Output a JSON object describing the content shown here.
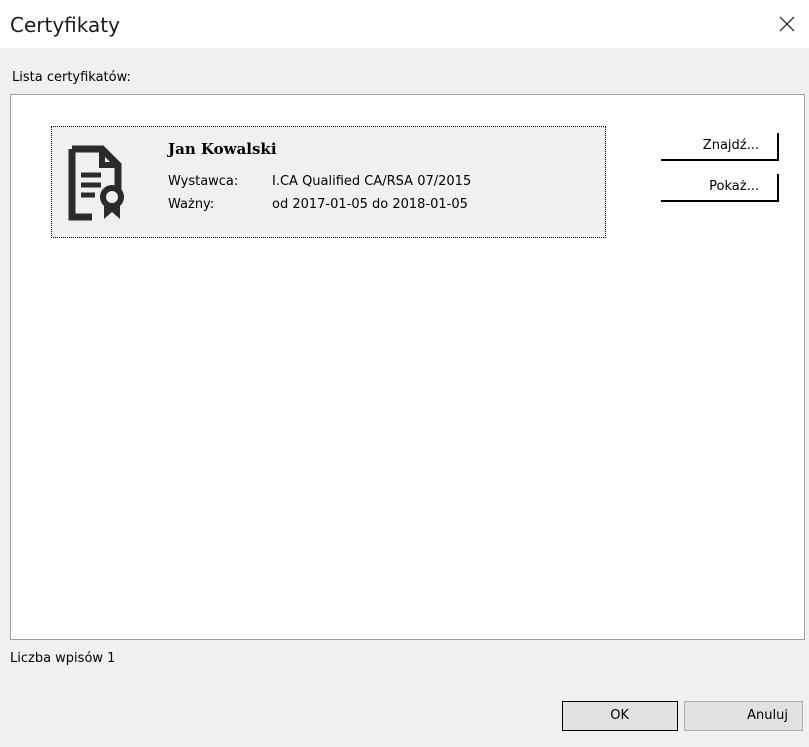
{
  "window": {
    "title": "Certyfikaty"
  },
  "certificates": {
    "list_label": "Lista certyfikatów:",
    "items": [
      {
        "name": "Jan Kowalski",
        "issuer_label": "Wystawca:",
        "issuer": "I.CA Qualified CA/RSA 07/2015",
        "valid_label": "Ważny:",
        "valid": "od 2017-01-05 do 2018-01-05",
        "icon": "certificate-icon"
      }
    ],
    "find_label": "Znajdź...",
    "show_label": "Pokaż...",
    "count_label": "Liczba wpisów 1"
  },
  "footer": {
    "ok_label": "OK",
    "cancel_label": "Anuluj"
  },
  "icons": {
    "close": "close-icon",
    "certificate": "certificate-icon"
  },
  "colors": {
    "dialog_bg": "#f0f0f0",
    "titlebar_bg": "#ffffff",
    "list_bg": "#ffffff",
    "entry_bg": "#f0f0f0",
    "icon": "#2b2b2b"
  }
}
